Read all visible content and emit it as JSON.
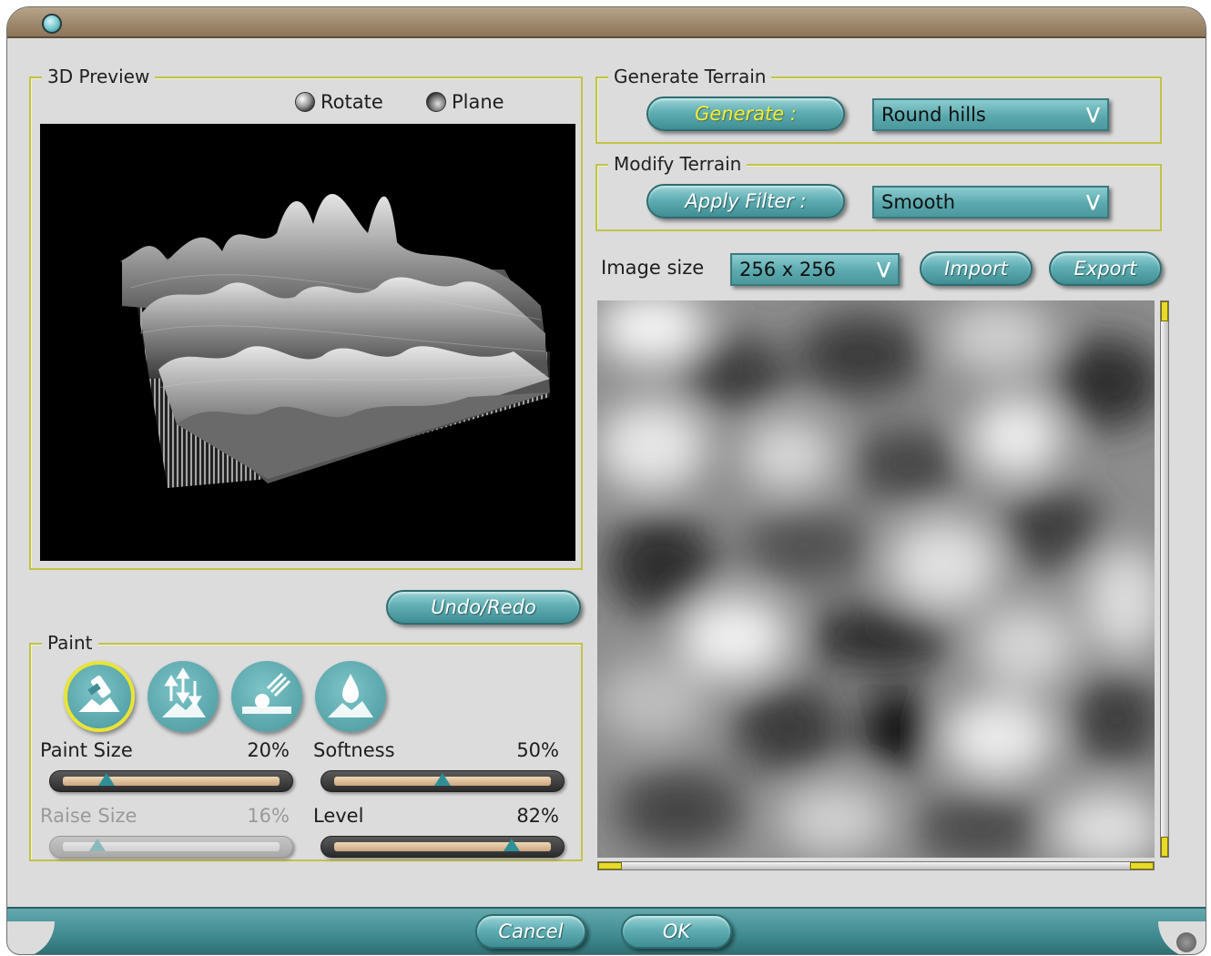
{
  "window": {
    "title": ""
  },
  "preview": {
    "group_label": "3D Preview",
    "mode_rotate": "Rotate",
    "mode_plane": "Plane",
    "selected_mode": "Rotate"
  },
  "generate": {
    "group_label": "Generate Terrain",
    "button": "Generate :",
    "selected": "Round hills"
  },
  "modify": {
    "group_label": "Modify Terrain",
    "button": "Apply Filter :",
    "selected": "Smooth"
  },
  "image": {
    "size_label": "Image size",
    "size_value": "256 x 256",
    "import": "Import",
    "export": "Export"
  },
  "undo_redo": "Undo/Redo",
  "paint": {
    "group_label": "Paint",
    "tools": [
      {
        "name": "brush-tool",
        "icon": "paint-brush-icon",
        "active": true
      },
      {
        "name": "raise-lower-tool",
        "icon": "raise-lower-icon",
        "active": false
      },
      {
        "name": "smudge-tool",
        "icon": "smudge-icon",
        "active": false
      },
      {
        "name": "drop-tool",
        "icon": "water-drop-icon",
        "active": false
      }
    ],
    "sliders": {
      "paint_size": {
        "label": "Paint Size",
        "value": "20%",
        "fraction": 0.2,
        "enabled": true
      },
      "softness": {
        "label": "Softness",
        "value": "50%",
        "fraction": 0.5,
        "enabled": true
      },
      "raise_size": {
        "label": "Raise Size",
        "value": "16%",
        "fraction": 0.16,
        "enabled": false
      },
      "level": {
        "label": "Level",
        "value": "82%",
        "fraction": 0.82,
        "enabled": true
      }
    }
  },
  "footer": {
    "cancel": "Cancel",
    "ok": "OK"
  },
  "colors": {
    "accent": "#5faeb3",
    "frame": "#c2c24a",
    "highlight": "#e9e534"
  }
}
